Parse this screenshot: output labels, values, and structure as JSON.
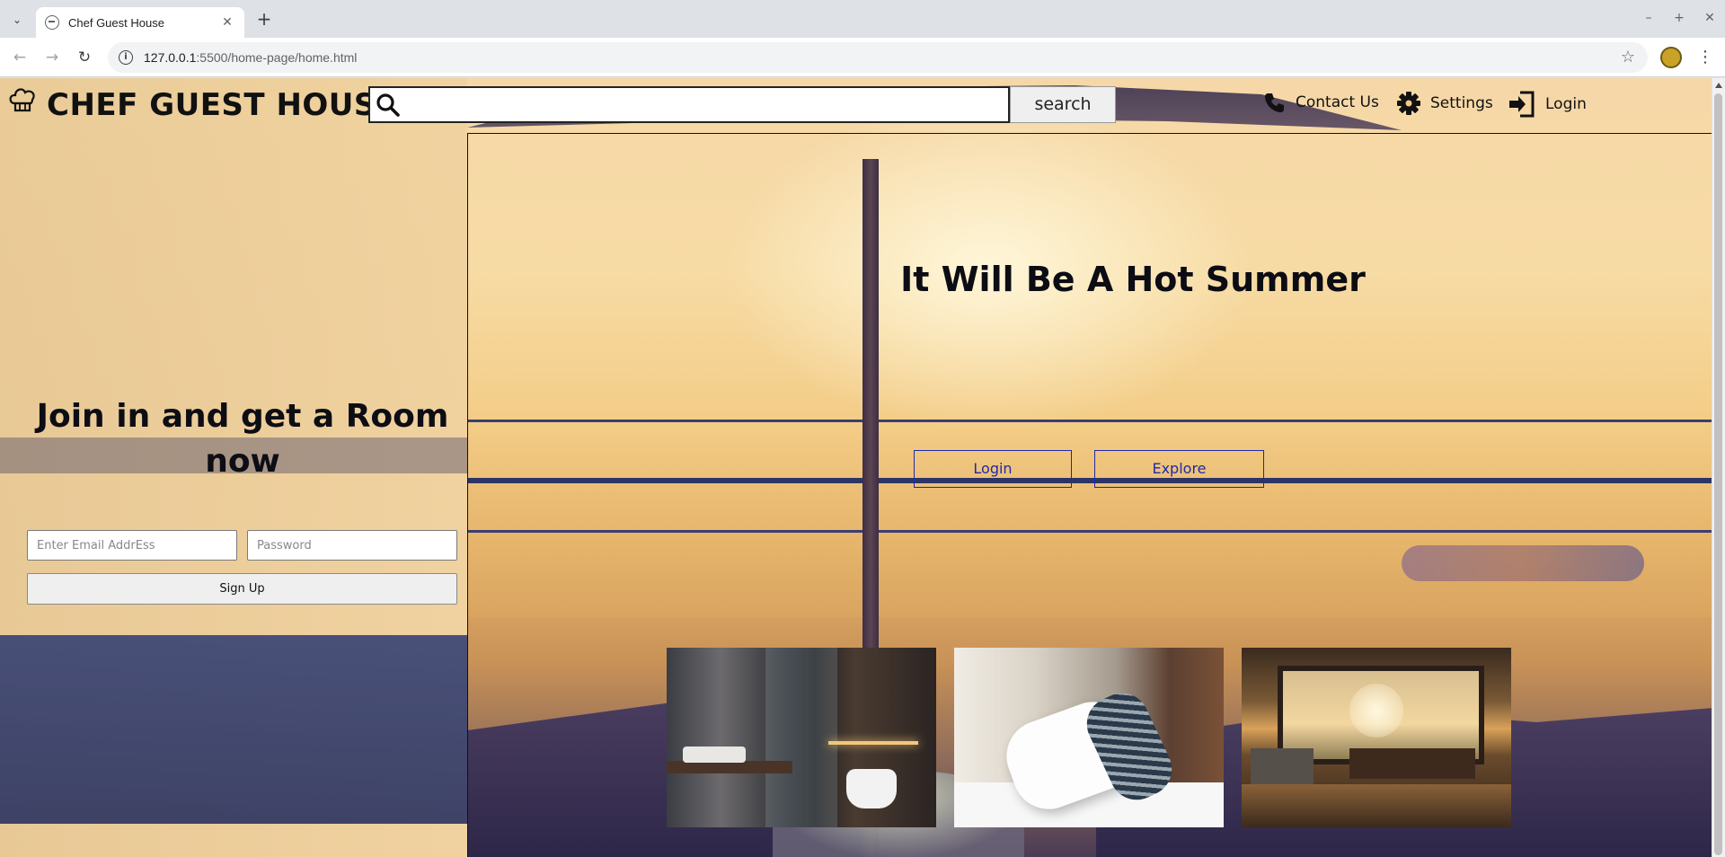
{
  "browser": {
    "tab_title": "Chef Guest House",
    "url_host": "127.0.0.1",
    "url_path": ":5500/home-page/home.html",
    "new_tab": "+",
    "tab_close": "✕",
    "minimize": "–",
    "maximize": "+",
    "close": "✕"
  },
  "nav": {
    "brand": "CHEF GUEST HOUSE",
    "search_placeholder": "",
    "search_button": "search",
    "links": {
      "contact": "Contact Us",
      "settings": "Settings",
      "login": "Login"
    }
  },
  "hero": {
    "title": "It Will Be A Hot Summer",
    "login_button": "Login",
    "explore_button": "Explore",
    "gallery": [
      "bathroom-photo",
      "bedroom-pillows-photo",
      "sunset-lounge-photo"
    ]
  },
  "join": {
    "title": "Join in and get a Room now",
    "email_placeholder": "Enter Email AddrEss",
    "password_placeholder": "Password",
    "signup_button": "Sign Up"
  },
  "colors": {
    "accent_link": "#1e2aa8",
    "text_dark": "#111111"
  }
}
